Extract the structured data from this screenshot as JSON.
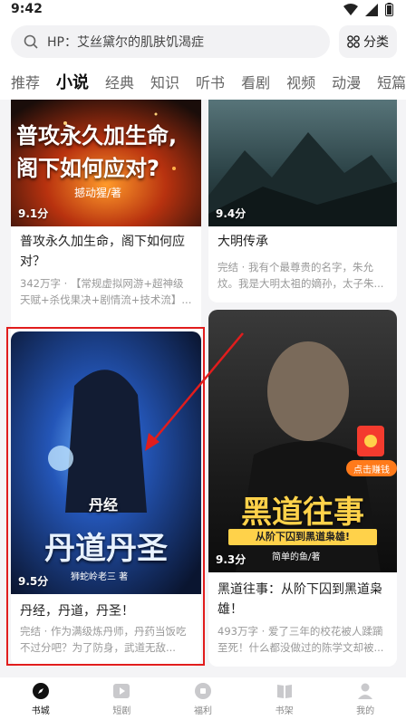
{
  "status_bar": {
    "time": "9:42"
  },
  "search": {
    "placeholder": "HP：艾丝黛尔的肌肤饥渴症"
  },
  "category_button": {
    "label": "分类"
  },
  "tabs": [
    {
      "label": "推荐"
    },
    {
      "label": "小说"
    },
    {
      "label": "经典"
    },
    {
      "label": "知识"
    },
    {
      "label": "听书"
    },
    {
      "label": "看剧"
    },
    {
      "label": "视频"
    },
    {
      "label": "动漫"
    },
    {
      "label": "短篇"
    }
  ],
  "books": [
    {
      "cover_title_1": "普攻永久加生命,",
      "cover_title_2": "阁下如何应对?",
      "cover_author": "撼动猩/著",
      "score": "9.1分",
      "title": "普攻永久加生命，阁下如何应对？",
      "desc": "342万字 · 【常规虚拟网游+超神级天赋+杀伐果决+剧情流+技术流】..."
    },
    {
      "score": "9.4分",
      "title": "大明传承",
      "desc": "完结 · 我有个最尊贵的名字，朱允炆。我是大明太祖的嫡孙，太子朱..."
    },
    {
      "cover_title_small": "丹经",
      "cover_title_big": "丹道丹圣",
      "cover_author": "狮蛇岭老三 著",
      "score": "9.5分",
      "title": "丹经，丹道，丹圣！",
      "desc": "完结 · 作为满级炼丹师，丹药当饭吃不过分吧？为了防身，武道无敌..."
    },
    {
      "cover_title_big": "黑道往事",
      "cover_subtitle": "从阶下囚到黑道枭雄!",
      "cover_author": "简单的鱼/著",
      "score": "9.3分",
      "title": "黑道往事：从阶下囚到黑道枭雄！",
      "desc": "493万字 · 爱了三年的校花被人蹂躏至死！什么都没做过的陈学文却被..."
    }
  ],
  "red_packet": {
    "label": "点击赚钱"
  },
  "bottom_nav": [
    {
      "label": "书城"
    },
    {
      "label": "短剧"
    },
    {
      "label": "福利"
    },
    {
      "label": "书架"
    },
    {
      "label": "我的"
    }
  ],
  "colors": {
    "highlight": "#e11d1d",
    "red_packet": "#f43b2e",
    "active_text": "#111111"
  }
}
